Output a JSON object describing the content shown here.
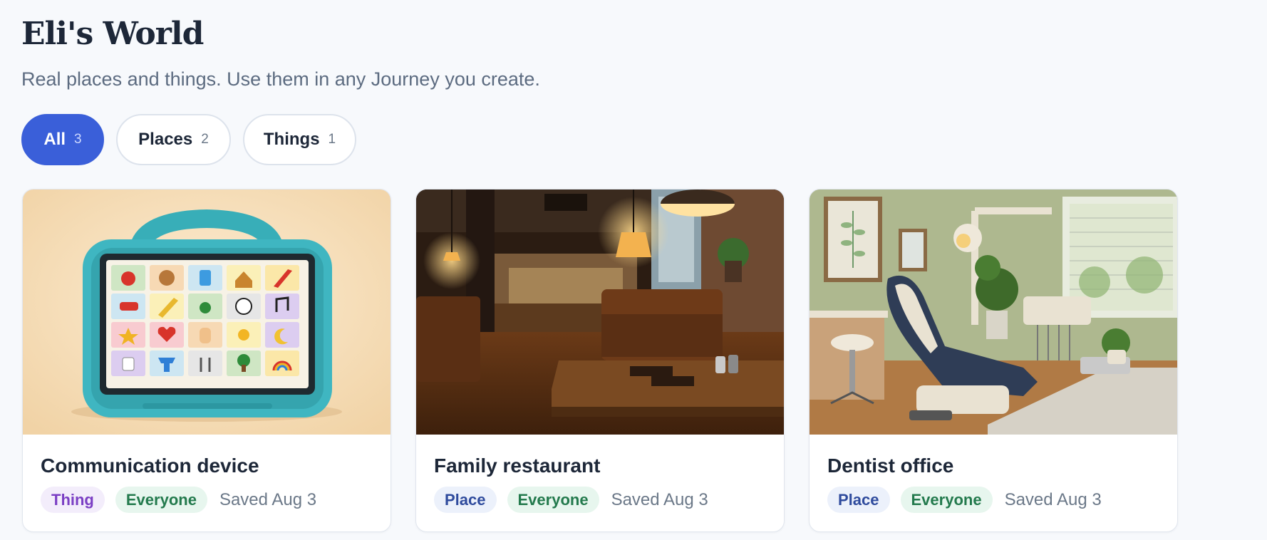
{
  "header": {
    "title": "Eli's World",
    "subtitle": "Real places and things. Use them in any Journey you create."
  },
  "filters": [
    {
      "label": "All",
      "count": "3",
      "active": true
    },
    {
      "label": "Places",
      "count": "2",
      "active": false
    },
    {
      "label": "Things",
      "count": "1",
      "active": false
    }
  ],
  "cards": [
    {
      "title": "Communication device",
      "type": "Thing",
      "audience": "Everyone",
      "saved": "Saved Aug 3",
      "image": "tablet-illustration"
    },
    {
      "title": "Family restaurant",
      "type": "Place",
      "audience": "Everyone",
      "saved": "Saved Aug 3",
      "image": "restaurant-photo"
    },
    {
      "title": "Dentist office",
      "type": "Place",
      "audience": "Everyone",
      "saved": "Saved Aug 3",
      "image": "dentist-photo"
    }
  ],
  "colors": {
    "accent": "#3a5fd9",
    "thing_badge": "#7b3fc4",
    "place_badge": "#2f4b9d",
    "everyone_badge": "#237a4d"
  }
}
